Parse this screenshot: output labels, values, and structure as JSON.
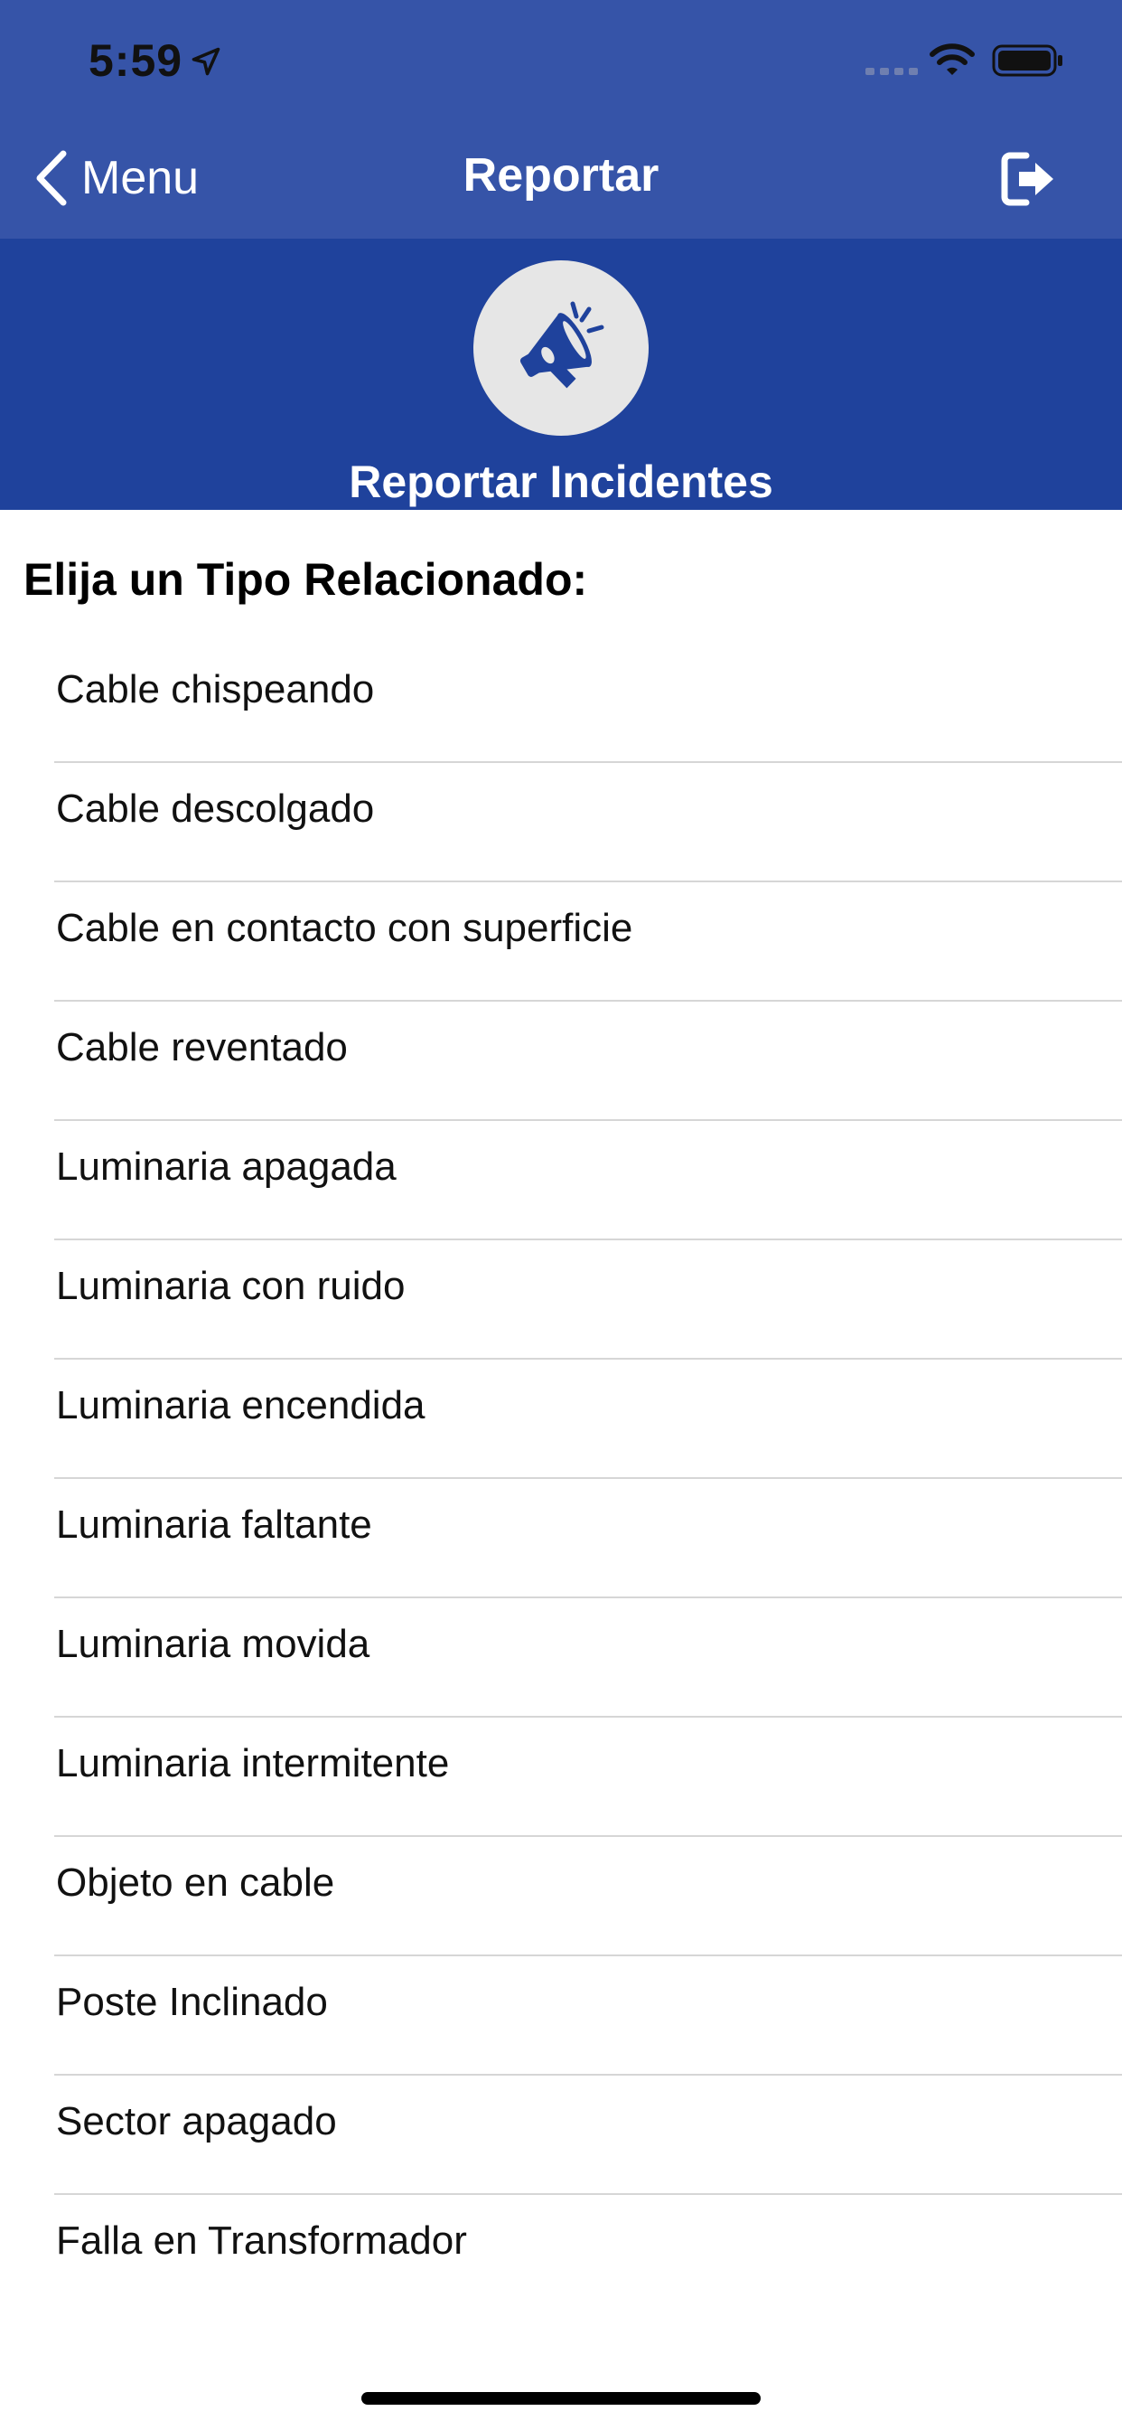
{
  "status_bar": {
    "time": "5:59"
  },
  "nav": {
    "back_label": "Menu",
    "title": "Reportar"
  },
  "hero": {
    "title": "Reportar Incidentes"
  },
  "content": {
    "heading": "Elija un Tipo Relacionado:",
    "items": [
      {
        "label": "Cable chispeando"
      },
      {
        "label": "Cable descolgado"
      },
      {
        "label": "Cable en contacto con superficie"
      },
      {
        "label": "Cable reventado"
      },
      {
        "label": "Luminaria apagada"
      },
      {
        "label": "Luminaria con ruido"
      },
      {
        "label": "Luminaria encendida"
      },
      {
        "label": "Luminaria faltante"
      },
      {
        "label": "Luminaria movida"
      },
      {
        "label": "Luminaria intermitente"
      },
      {
        "label": "Objeto en cable"
      },
      {
        "label": "Poste Inclinado"
      },
      {
        "label": "Sector apagado"
      },
      {
        "label": "Falla en Transformador"
      }
    ]
  },
  "colors": {
    "nav_background": "#3654a8",
    "hero_background": "#1f429c",
    "icon_circle": "#e6e6e6",
    "divider": "#d6d6d6"
  }
}
